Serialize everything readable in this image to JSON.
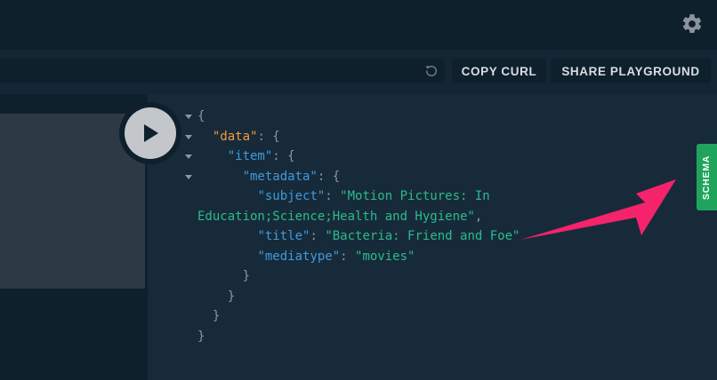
{
  "toolbar": {
    "url_value": "",
    "copy_curl_label": "COPY CURL",
    "share_label": "SHARE PLAYGROUND"
  },
  "result": {
    "lines": [
      {
        "indent": "",
        "parts": [
          {
            "t": "{",
            "c": "p"
          }
        ]
      },
      {
        "indent": "  ",
        "parts": [
          {
            "t": "\"data\"",
            "c": "kd"
          },
          {
            "t": ": {",
            "c": "p"
          }
        ]
      },
      {
        "indent": "    ",
        "parts": [
          {
            "t": "\"item\"",
            "c": "k"
          },
          {
            "t": ": {",
            "c": "p"
          }
        ]
      },
      {
        "indent": "      ",
        "parts": [
          {
            "t": "\"metadata\"",
            "c": "k"
          },
          {
            "t": ": {",
            "c": "p"
          }
        ]
      },
      {
        "indent": "        ",
        "parts": [
          {
            "t": "\"subject\"",
            "c": "k"
          },
          {
            "t": ": ",
            "c": "p"
          },
          {
            "t": "\"Motion Pictures: In",
            "c": "s"
          }
        ]
      },
      {
        "indent": "",
        "parts": [
          {
            "t": "Education;Science;Health and Hygiene\"",
            "c": "s"
          },
          {
            "t": ",",
            "c": "p"
          }
        ]
      },
      {
        "indent": "        ",
        "parts": [
          {
            "t": "\"title\"",
            "c": "k"
          },
          {
            "t": ": ",
            "c": "p"
          },
          {
            "t": "\"Bacteria: Friend and Foe\"",
            "c": "s"
          }
        ]
      },
      {
        "indent": "        ",
        "parts": [
          {
            "t": "\"mediatype\"",
            "c": "k"
          },
          {
            "t": ": ",
            "c": "p"
          },
          {
            "t": "\"movies\"",
            "c": "s"
          }
        ]
      },
      {
        "indent": "      ",
        "parts": [
          {
            "t": "}",
            "c": "p"
          }
        ]
      },
      {
        "indent": "    ",
        "parts": [
          {
            "t": "}",
            "c": "p"
          }
        ]
      },
      {
        "indent": "  ",
        "parts": [
          {
            "t": "}",
            "c": "p"
          }
        ]
      },
      {
        "indent": "",
        "parts": [
          {
            "t": "}",
            "c": "p"
          }
        ]
      }
    ]
  },
  "schema_tab": {
    "label": "SCHEMA"
  },
  "icons": {
    "settings": "gear-icon",
    "reset": "reset-icon",
    "run": "play-icon",
    "annotation": "arrow-annotation"
  },
  "colors": {
    "background": "#172a3a",
    "schema_tab": "#1fa55b",
    "annotation_arrow": "#f5236b",
    "key_data": "#f29b3c",
    "key": "#3f9bdc",
    "string": "#2bbc8a"
  }
}
